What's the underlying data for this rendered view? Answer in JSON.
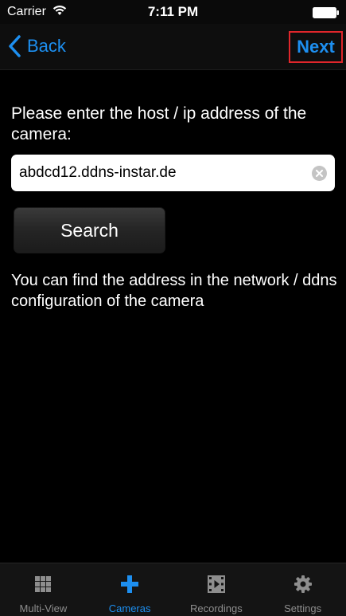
{
  "status_bar": {
    "carrier": "Carrier",
    "time": "7:11 PM"
  },
  "nav": {
    "back_label": "Back",
    "next_label": "Next"
  },
  "form": {
    "prompt": "Please enter the host / ip address of the camera:",
    "host_value": "abdcd12.ddns-instar.de",
    "search_label": "Search",
    "hint": "You can find the address in the network / ddns configuration of the camera"
  },
  "tabs": [
    {
      "label": "Multi-View",
      "icon": "grid-icon",
      "active": false
    },
    {
      "label": "Cameras",
      "icon": "plus-icon",
      "active": true
    },
    {
      "label": "Recordings",
      "icon": "film-icon",
      "active": false
    },
    {
      "label": "Settings",
      "icon": "gear-icon",
      "active": false
    }
  ],
  "colors": {
    "accent": "#1d8ff0",
    "highlight": "#e0262b",
    "background": "#000000"
  }
}
